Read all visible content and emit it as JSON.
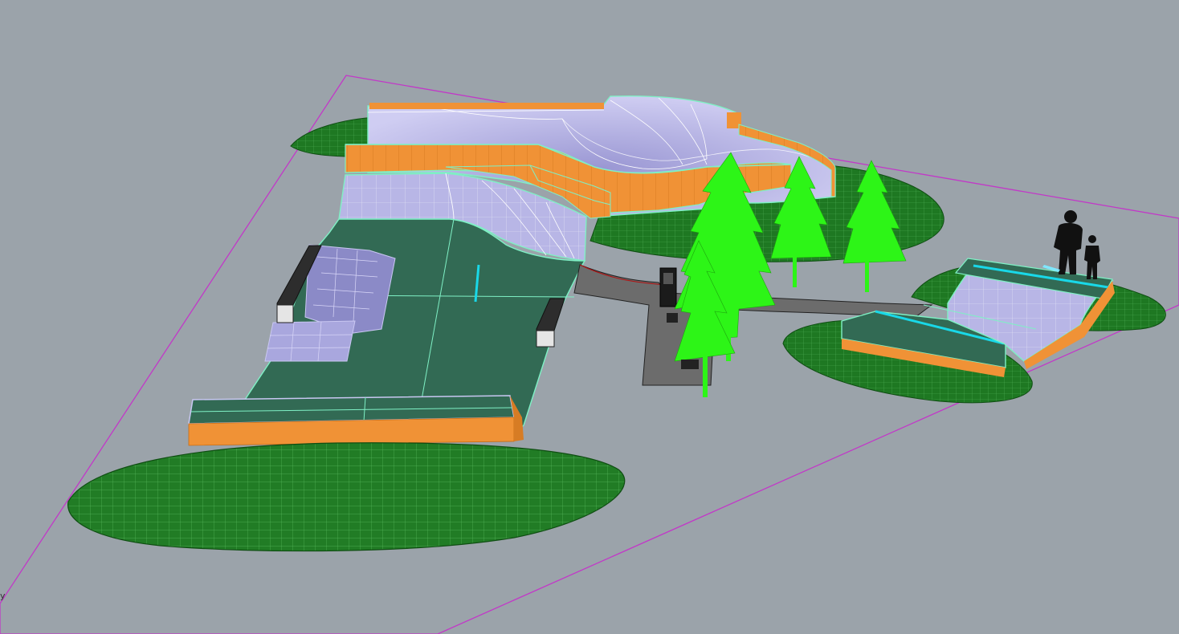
{
  "viewport": {
    "name": "Perspective",
    "background": "#9ba3aa",
    "axis_label": "y"
  },
  "scene": {
    "boundary_color": "#c238c8",
    "grass_color": "#1f7a23",
    "grass_wire_color": "#53b95a",
    "coping_color": "#f09236",
    "ramp_color": "#b9b7e6",
    "flat_color": "#326a54",
    "edge_color": "#7ff0c5",
    "tree_color": "#2df517",
    "path_color": "#6c6c6c",
    "silhouette_color": "#111111",
    "rail_color": "#19d8e8"
  }
}
